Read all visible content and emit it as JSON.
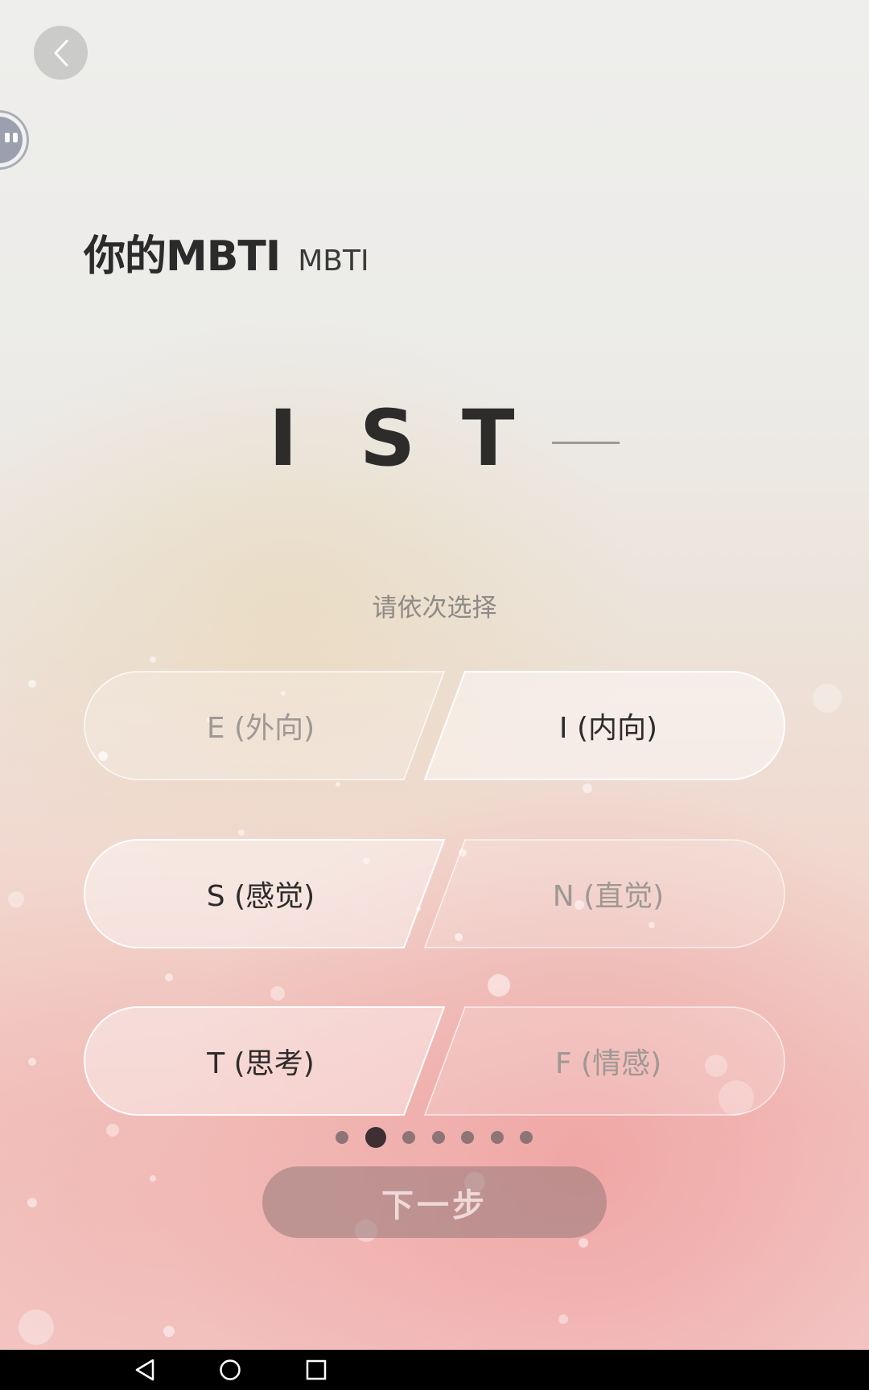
{
  "header": {
    "title": "你的MBTI",
    "subtitle": "MBTI"
  },
  "result": {
    "letters": [
      "I",
      "S",
      "T"
    ],
    "pending_placeholder": "—"
  },
  "hint": "请依次选择",
  "options": [
    {
      "left": {
        "label": "E (外向)",
        "selected": false
      },
      "right": {
        "label": "I (内向)",
        "selected": true
      }
    },
    {
      "left": {
        "label": "S (感觉)",
        "selected": true
      },
      "right": {
        "label": "N (直觉)",
        "selected": false
      }
    },
    {
      "left": {
        "label": "T (思考)",
        "selected": true
      },
      "right": {
        "label": "F (情感)",
        "selected": false
      }
    }
  ],
  "pagination": {
    "total": 7,
    "current": 2
  },
  "next_button": {
    "label": "下一步",
    "enabled": false
  },
  "icons": {
    "back": "chevron-left-icon",
    "widget": "floating-assistant-icon",
    "nav_back": "triangle-back-icon",
    "nav_home": "circle-home-icon",
    "nav_recents": "square-recents-icon"
  },
  "colors": {
    "selected_text": "#2f2b2b",
    "unselected_text": "#9f9894",
    "dot": "#8e7474",
    "active_dot": "#3e2f33"
  }
}
